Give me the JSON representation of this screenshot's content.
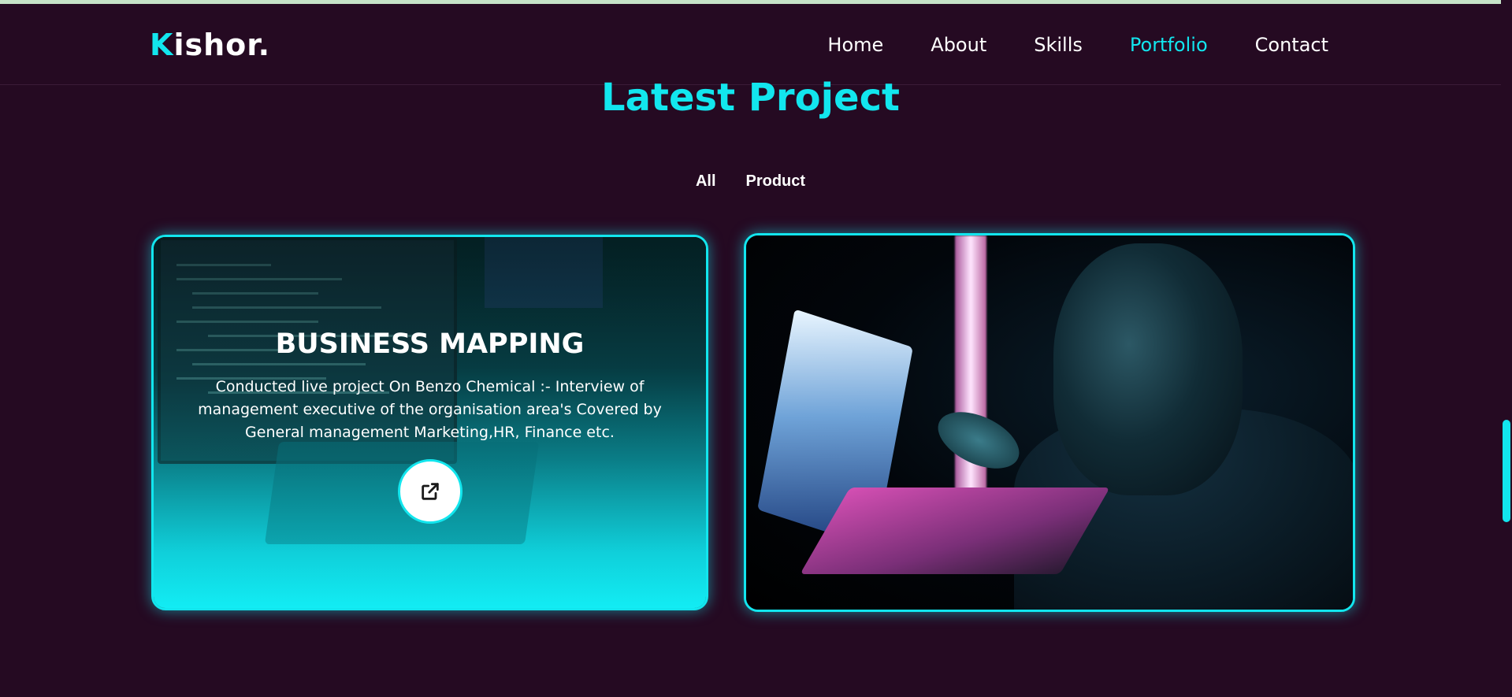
{
  "logo": {
    "first_letter": "K",
    "rest": "ishor."
  },
  "nav": {
    "items": [
      {
        "label": "Home"
      },
      {
        "label": "About"
      },
      {
        "label": "Skills"
      },
      {
        "label": "Portfolio"
      },
      {
        "label": "Contact"
      }
    ],
    "active": "Portfolio"
  },
  "section": {
    "title": "Latest Project"
  },
  "filters": [
    {
      "label": "All"
    },
    {
      "label": "Product"
    }
  ],
  "projects": [
    {
      "title": "BUSINESS MAPPING",
      "description": "Conducted live project On Benzo Chemical :- Interview of management executive of the organisation area's Covered by General management Marketing,HR, Finance etc.",
      "link_icon": "external-link-icon"
    },
    {
      "image": "man-using-laptop-in-dark-photo"
    }
  ],
  "colors": {
    "accent": "#12e6ee",
    "background": "#250a22",
    "text": "#ffffff"
  }
}
